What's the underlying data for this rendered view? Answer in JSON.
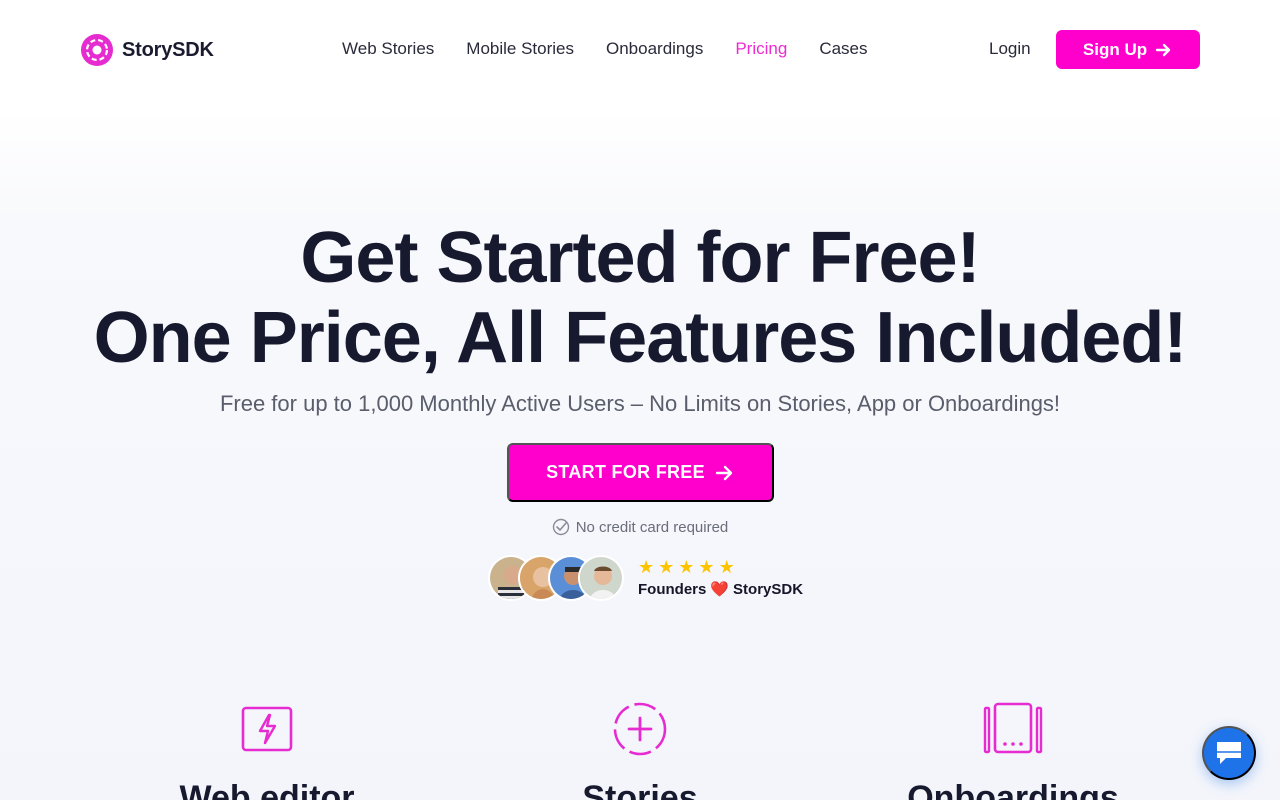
{
  "brand": {
    "name": "StorySDK",
    "accent": "#ff00cc",
    "logo_color": "#e62bd1"
  },
  "nav": {
    "items": [
      {
        "label": "Web Stories",
        "active": false
      },
      {
        "label": "Mobile Stories",
        "active": false
      },
      {
        "label": "Onboardings",
        "active": false
      },
      {
        "label": "Pricing",
        "active": true
      },
      {
        "label": "Cases",
        "active": false
      }
    ],
    "login_label": "Login",
    "signup_label": "Sign Up",
    "signup_icon": "arrow-right-icon"
  },
  "hero": {
    "title_line1": "Get Started for Free!",
    "title_line2": "One Price, All Features Included!",
    "subtitle": "Free for up to 1,000 Monthly Active Users – No Limits on Stories, App or Onboardings!",
    "cta_label": "START FOR FREE",
    "cta_icon": "arrow-right-icon",
    "no_credit_card": "No credit card required",
    "no_credit_card_icon": "check-circle-icon"
  },
  "social_proof": {
    "avatars": [
      "avatar-1",
      "avatar-2",
      "avatar-3",
      "avatar-4"
    ],
    "rating": 5,
    "text_before": "Founders",
    "heart": "❤️",
    "text_after": "StorySDK"
  },
  "features": [
    {
      "title": "Web editor",
      "icon": "lightning-icon"
    },
    {
      "title": "Stories",
      "icon": "plus-circle-icon"
    },
    {
      "title": "Onboardings",
      "icon": "onboarding-cards-icon"
    }
  ],
  "chat": {
    "icon": "chat-icon",
    "color": "#1e73e8"
  }
}
